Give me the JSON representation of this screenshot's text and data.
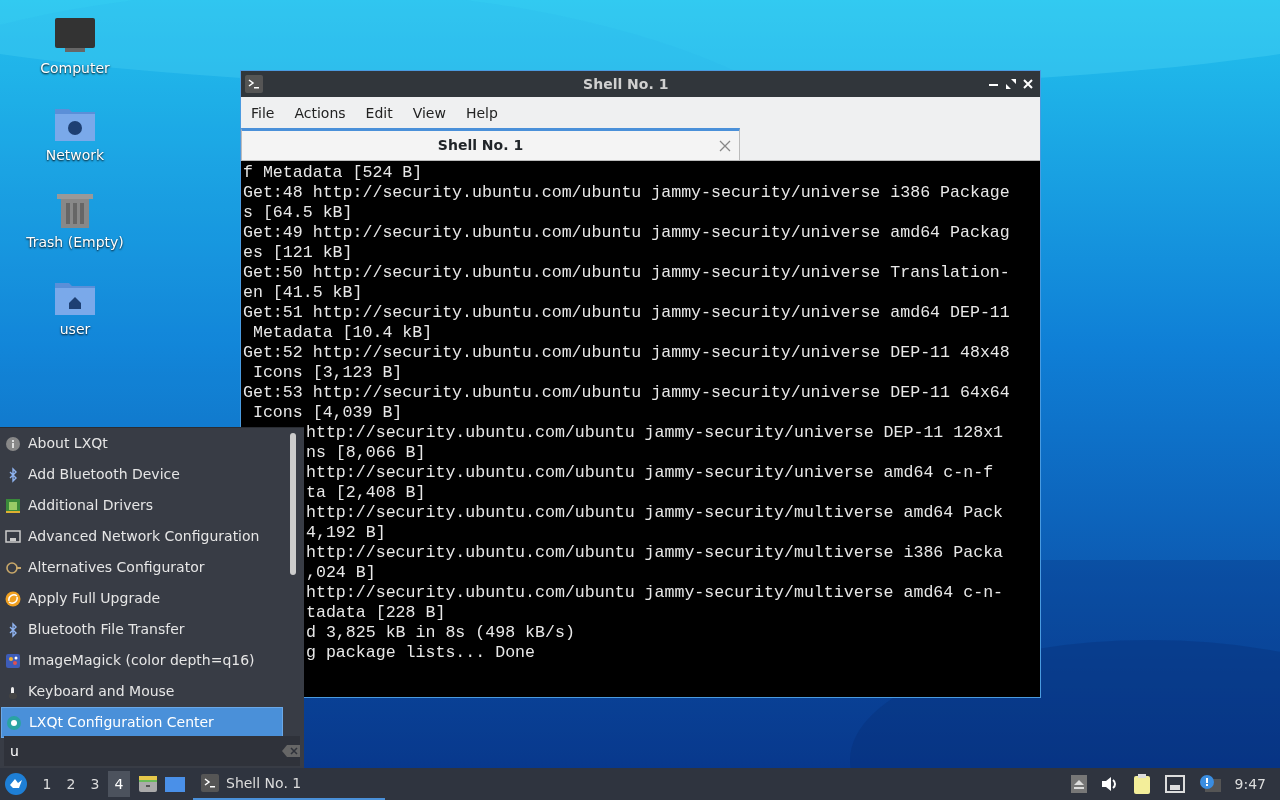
{
  "desktop_icons": [
    {
      "label": "Computer",
      "kind": "computer"
    },
    {
      "label": "Network",
      "kind": "network"
    },
    {
      "label": "Trash (Empty)",
      "kind": "trash"
    },
    {
      "label": "user",
      "kind": "home"
    }
  ],
  "window": {
    "title": "Shell No. 1",
    "menu": [
      "File",
      "Actions",
      "Edit",
      "View",
      "Help"
    ],
    "tabs": [
      {
        "label": "Shell No. 1",
        "selected": true
      }
    ],
    "terminal_lines": [
      "f Metadata [524 B]",
      "Get:48 http://security.ubuntu.com/ubuntu jammy-security/universe i386 Package",
      "s [64.5 kB]",
      "Get:49 http://security.ubuntu.com/ubuntu jammy-security/universe amd64 Packag",
      "es [121 kB]",
      "Get:50 http://security.ubuntu.com/ubuntu jammy-security/universe Translation-",
      "en [41.5 kB]",
      "Get:51 http://security.ubuntu.com/ubuntu jammy-security/universe amd64 DEP-11",
      " Metadata [10.4 kB]",
      "Get:52 http://security.ubuntu.com/ubuntu jammy-security/universe DEP-11 48x48",
      " Icons [3,123 B]",
      "Get:53 http://security.ubuntu.com/ubuntu jammy-security/universe DEP-11 64x64",
      " Icons [4,039 B]"
    ],
    "terminal_lines_behind_menu": [
      "http://security.ubuntu.com/ubuntu jammy-security/universe DEP-11 128x1",
      "ns [8,066 B]",
      "http://security.ubuntu.com/ubuntu jammy-security/universe amd64 c-n-f",
      "ta [2,408 B]",
      "http://security.ubuntu.com/ubuntu jammy-security/multiverse amd64 Pack",
      "4,192 B]",
      "http://security.ubuntu.com/ubuntu jammy-security/multiverse i386 Packa",
      ",024 B]",
      "http://security.ubuntu.com/ubuntu jammy-security/multiverse amd64 c-n-",
      "tadata [228 B]",
      "d 3,825 kB in 8s (498 kB/s)",
      "g package lists... Done"
    ]
  },
  "app_menu": {
    "items": [
      {
        "label": "About LXQt",
        "kind": "info",
        "selected": false
      },
      {
        "label": "Add Bluetooth Device",
        "kind": "bluetooth",
        "selected": false
      },
      {
        "label": "Additional Drivers",
        "kind": "chip",
        "selected": false
      },
      {
        "label": "Advanced Network Configuration",
        "kind": "port",
        "selected": false
      },
      {
        "label": "Alternatives Configurator",
        "kind": "alternatives",
        "selected": false
      },
      {
        "label": "Apply Full Upgrade",
        "kind": "upgrade",
        "selected": false
      },
      {
        "label": "Bluetooth File Transfer",
        "kind": "bluetooth",
        "selected": false
      },
      {
        "label": "ImageMagick (color depth=q16)",
        "kind": "imagemagick",
        "selected": false
      },
      {
        "label": "Keyboard and Mouse",
        "kind": "mouse",
        "selected": false
      },
      {
        "label": "LXQt Configuration Center",
        "kind": "config",
        "selected": true
      }
    ],
    "search": {
      "value": "u"
    }
  },
  "taskbar": {
    "workspaces": [
      {
        "label": "1",
        "selected": false
      },
      {
        "label": "2",
        "selected": false
      },
      {
        "label": "3",
        "selected": false
      },
      {
        "label": "4",
        "selected": true
      }
    ],
    "tasks": [
      {
        "label": "Shell No. 1",
        "selected": true
      }
    ],
    "clock": "9:47"
  }
}
